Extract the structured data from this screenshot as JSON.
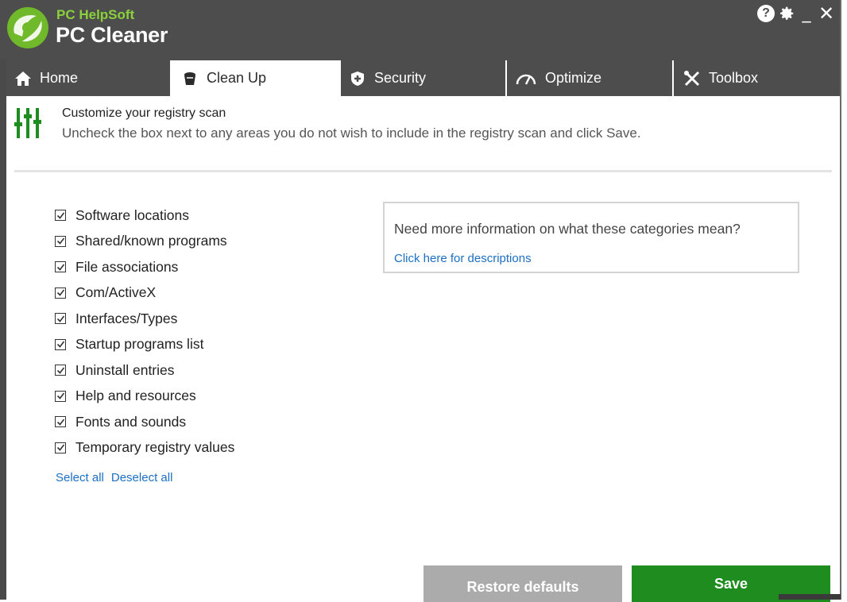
{
  "app": {
    "brand_top": "PC HelpSoft",
    "brand_main": "PC Cleaner",
    "accent_green": "#8bd13c",
    "header_bg": "#4d4d4d"
  },
  "window_controls": {
    "help_icon": "?",
    "gear_icon": "✿",
    "minimize_icon": "_",
    "close_icon": "✕"
  },
  "tabs": [
    {
      "label": "Home",
      "icon": "home-icon",
      "active": false
    },
    {
      "label": "Clean Up",
      "icon": "broom-icon",
      "active": true
    },
    {
      "label": "Security",
      "icon": "shield-icon",
      "active": false
    },
    {
      "label": "Optimize",
      "icon": "gauge-icon",
      "active": false
    },
    {
      "label": "Toolbox",
      "icon": "tools-icon",
      "active": false
    }
  ],
  "header": {
    "title": "Customize your registry scan",
    "subtitle": "Uncheck the box next to any areas you do not wish to include in the registry scan and click Save.",
    "icon": "sliders-icon",
    "icon_color": "#1e8c1e"
  },
  "checklist": [
    {
      "label": "Software locations",
      "checked": true
    },
    {
      "label": "Shared/known programs",
      "checked": true
    },
    {
      "label": "File associations",
      "checked": true
    },
    {
      "label": "Com/ActiveX",
      "checked": true
    },
    {
      "label": "Interfaces/Types",
      "checked": true
    },
    {
      "label": "Startup programs list",
      "checked": true
    },
    {
      "label": "Uninstall entries",
      "checked": true
    },
    {
      "label": "Help and resources",
      "checked": true
    },
    {
      "label": "Fonts and sounds",
      "checked": true
    },
    {
      "label": "Temporary registry values",
      "checked": true
    }
  ],
  "selection_links": {
    "select_all": "Select all",
    "deselect_all": "Deselect all"
  },
  "info_box": {
    "question": "Need more information on what these categories mean?",
    "link": "Click here for descriptions"
  },
  "buttons": {
    "restore": "Restore defaults",
    "save": "Save",
    "save_color": "#1e8c1e",
    "restore_color": "#ababab"
  }
}
